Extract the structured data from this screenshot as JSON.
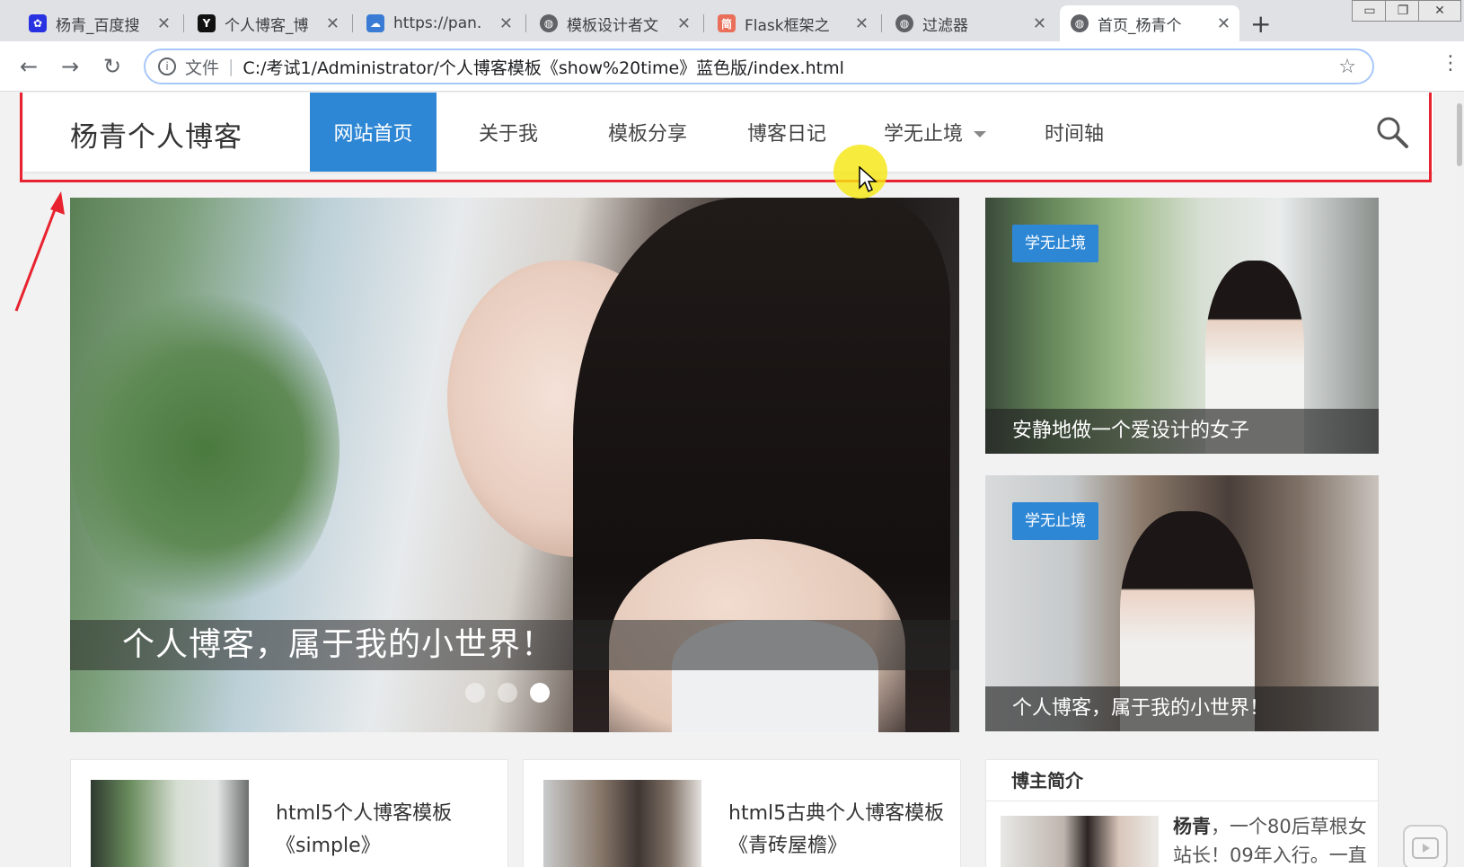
{
  "browser": {
    "tabs": [
      {
        "title": "杨青_百度搜",
        "icon": "baidu-paw-icon",
        "color": "#2932e1"
      },
      {
        "title": "个人博客_博",
        "icon": "y-letter-icon",
        "color": "#111111"
      },
      {
        "title": "https://pan.",
        "icon": "baidu-cloud-icon",
        "color": "#3a7bd5"
      },
      {
        "title": "模板设计者文",
        "icon": "globe-icon",
        "color": "#5f6368"
      },
      {
        "title": "Flask框架之",
        "icon": "jianshu-icon",
        "color": "#ea6f5a"
      },
      {
        "title": "过滤器",
        "icon": "globe-icon",
        "color": "#5f6368"
      },
      {
        "title": "首页_杨青个",
        "icon": "globe-icon",
        "color": "#5f6368"
      }
    ],
    "close_glyph": "✕",
    "new_tab_glyph": "+",
    "url_chip": "文件",
    "url": "C:/考试1/Administrator/个人博客模板《show%20time》蓝色版/index.html"
  },
  "site": {
    "logo": "杨青个人博客",
    "nav": [
      "网站首页",
      "关于我",
      "模板分享",
      "博客日记",
      "学无止境",
      "时间轴"
    ],
    "active_nav": "网站首页"
  },
  "hero": {
    "caption": "个人博客，属于我的小世界！",
    "slides": 3,
    "active_slide": 3
  },
  "side_cards": [
    {
      "tag": "学无止境",
      "caption": "安静地做一个爱设计的女子"
    },
    {
      "tag": "学无止境",
      "caption": "个人博客，属于我的小世界！"
    }
  ],
  "articles": [
    {
      "title": "html5个人博客模板《simple》"
    },
    {
      "title": "html5古典个人博客模板《青砖屋檐》"
    }
  ],
  "profile": {
    "heading": "博主简介",
    "name": "杨青",
    "text": "，一个80后草根女站长！09年入行。一直"
  },
  "colors": {
    "accent": "#2e87d5",
    "annotation": "#e8232f",
    "cursor_highlight": "#f5e614"
  }
}
